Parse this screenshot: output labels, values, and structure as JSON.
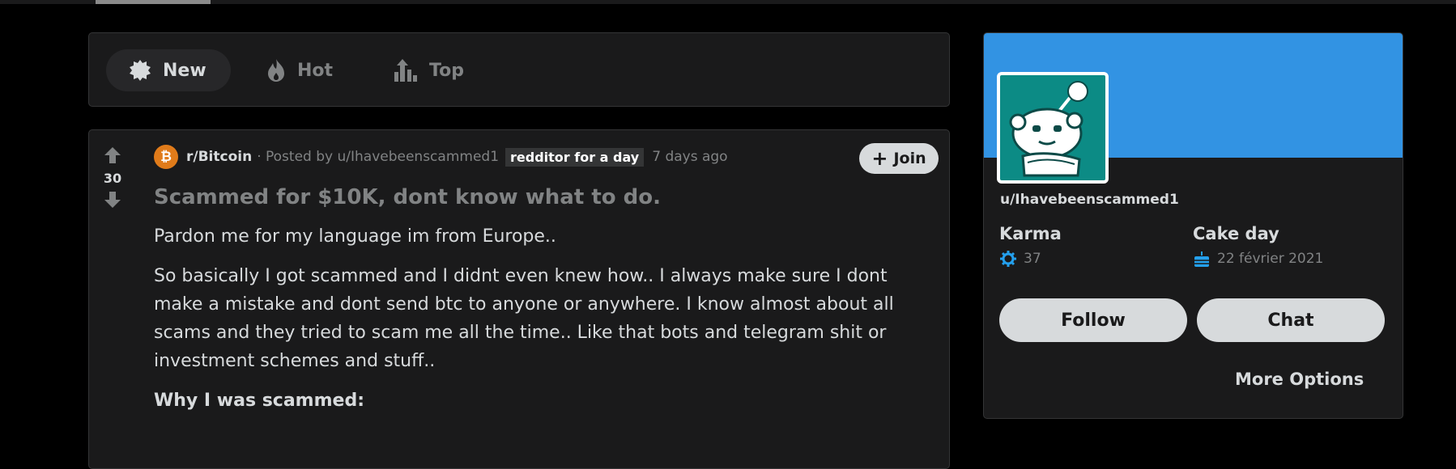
{
  "sort": {
    "new_label": "New",
    "hot_label": "Hot",
    "top_label": "Top"
  },
  "post": {
    "votes": "30",
    "subreddit": "r/Bitcoin",
    "posted_by": "· Posted by u/Ihavebeenscammed1",
    "flair": "redditor for a day",
    "time": "7 days ago",
    "join_label": "Join",
    "title": "Scammed for $10K, dont know what to do.",
    "body": [
      "Pardon me for my language im from Europe..",
      "So basically I got scammed and I didnt even knew how.. I always make sure I dont make a mistake and dont send btc to anyone or anywhere. I know almost about all scams and they tried to scam me all the time.. Like that bots and telegram shit or investment schemes and stuff.."
    ],
    "subheading": "Why I was scammed:"
  },
  "profile": {
    "username": "u/Ihavebeenscammed1",
    "karma_label": "Karma",
    "karma_value": "37",
    "cakeday_label": "Cake day",
    "cakeday_value": "22 février 2021",
    "follow_label": "Follow",
    "chat_label": "Chat",
    "more_options_label": "More Options"
  },
  "colors": {
    "banner": "#3293e3",
    "avatar_bg": "#0c8b85",
    "bitcoin": "#e07b1a",
    "karma_icon": "#24a0ed"
  }
}
